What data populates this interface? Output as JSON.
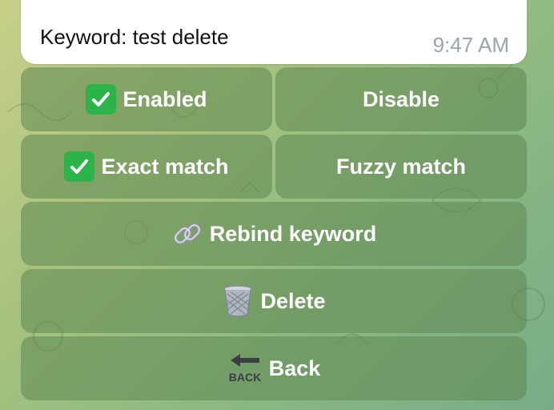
{
  "message": {
    "text": "Keyword: test delete",
    "time": "9:47 AM"
  },
  "keyboard": {
    "enabled_label": "Enabled",
    "disable_label": "Disable",
    "exact_match_label": "Exact match",
    "fuzzy_match_label": "Fuzzy match",
    "rebind_label": "Rebind keyword",
    "delete_label": "Delete",
    "back_label": "Back"
  },
  "icons": {
    "check": "check-mark-button-icon",
    "link": "link-icon",
    "trash": "wastebasket-icon",
    "back": "back-arrow-icon",
    "back_text": "BACK"
  },
  "colors": {
    "button_bg": "#6f9a5e",
    "check_green": "#2cb34a",
    "time_gray": "#9aa4ae"
  }
}
